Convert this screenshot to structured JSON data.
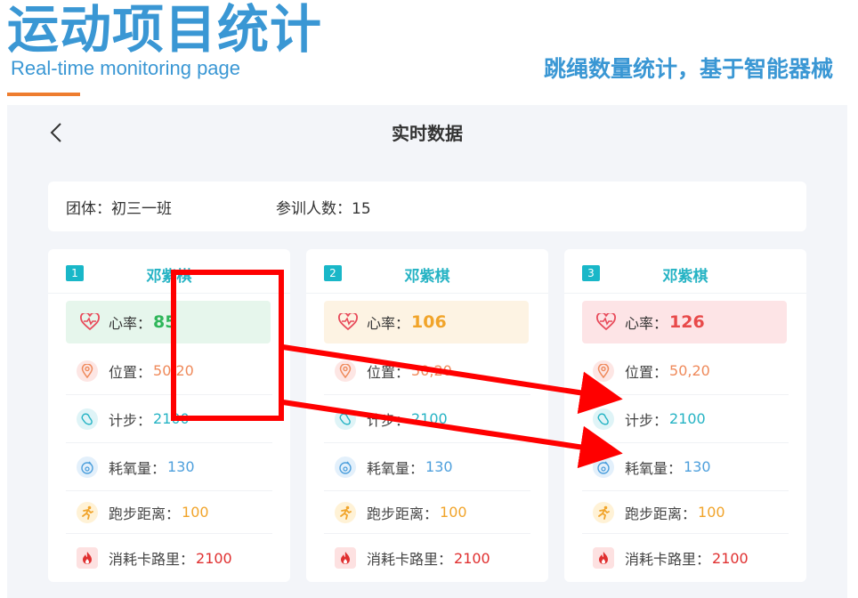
{
  "banner": {
    "main_title": "运动项目统计",
    "subtitle": "Real-time monitoring page",
    "right_title": "跳绳数量统计，基于智能器械"
  },
  "screen": {
    "title": "实时数据",
    "back_icon": "chevron-left-icon"
  },
  "group_bar": {
    "group": "团体：初三一班",
    "count": "参训人数：15"
  },
  "cards": [
    {
      "num": "1",
      "name": "邓紫棋",
      "hr_label": "心率：",
      "hr_value": "85",
      "hr_color": "#2fb65a",
      "hr_bg": "#e6f6ec",
      "position_label": "位置：",
      "position_value": "50,20",
      "steps_label": "计步：",
      "steps_value": "2100",
      "oxygen_label": "耗氧量：",
      "oxygen_value": "130",
      "run_label": "跑步距离：",
      "run_value": "100",
      "cal_label": "消耗卡路里：",
      "cal_value": "2100"
    },
    {
      "num": "2",
      "name": "邓紫棋",
      "hr_label": "心率：",
      "hr_value": "106",
      "hr_color": "#f1a42a",
      "hr_bg": "#fdf3e3",
      "position_label": "位置：",
      "position_value": "50,20",
      "steps_label": "计步：",
      "steps_value": "2100",
      "oxygen_label": "耗氧量：",
      "oxygen_value": "130",
      "run_label": "跑步距离：",
      "run_value": "100",
      "cal_label": "消耗卡路里：",
      "cal_value": "2100"
    },
    {
      "num": "3",
      "name": "邓紫棋",
      "hr_label": "心率：",
      "hr_value": "126",
      "hr_color": "#e84a4a",
      "hr_bg": "#fde4e6",
      "position_label": "位置：",
      "position_value": "50,20",
      "steps_label": "计步：",
      "steps_value": "2100",
      "oxygen_label": "耗氧量：",
      "oxygen_value": "130",
      "run_label": "跑步距离：",
      "run_value": "100",
      "cal_label": "消耗卡路里：",
      "cal_value": "2100"
    }
  ],
  "colors": {
    "position": "#ef8a5b",
    "steps": "#25b3c4",
    "oxygen": "#4d9fdc",
    "run": "#f1a42a",
    "calories": "#e03030",
    "annotation": "#ff0000"
  }
}
